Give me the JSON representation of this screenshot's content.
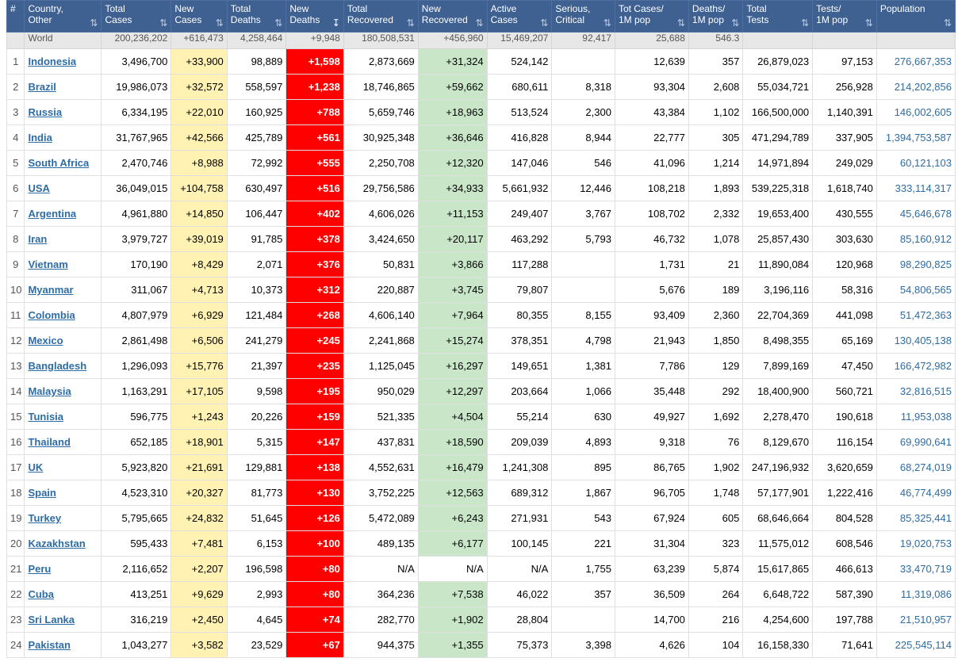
{
  "colors": {
    "header_bg": "#3e6192",
    "new_cases_bg": "#fff2b3",
    "new_deaths_bg": "#ff0000",
    "new_recovered_bg": "#c9e6c9",
    "link": "#2e6ca4"
  },
  "columns": [
    {
      "key": "rank",
      "label": "#",
      "sort": "none"
    },
    {
      "key": "country",
      "label": "Country,\nOther",
      "sort": "sort-icon"
    },
    {
      "key": "total_cases",
      "label": "Total\nCases",
      "sort": "sort-icon"
    },
    {
      "key": "new_cases",
      "label": "New\nCases",
      "sort": "sort-icon"
    },
    {
      "key": "total_deaths",
      "label": "Total\nDeaths",
      "sort": "sort-icon"
    },
    {
      "key": "new_deaths",
      "label": "New\nDeaths",
      "sort": "sort-desc-icon"
    },
    {
      "key": "total_recovered",
      "label": "Total\nRecovered",
      "sort": "sort-icon"
    },
    {
      "key": "new_recovered",
      "label": "New\nRecovered",
      "sort": "sort-icon"
    },
    {
      "key": "active_cases",
      "label": "Active\nCases",
      "sort": "sort-icon"
    },
    {
      "key": "serious",
      "label": "Serious,\nCritical",
      "sort": "sort-icon"
    },
    {
      "key": "cases_per_1m",
      "label": "Tot Cases/\n1M pop",
      "sort": "sort-icon"
    },
    {
      "key": "deaths_per_1m",
      "label": "Deaths/\n1M pop",
      "sort": "sort-icon"
    },
    {
      "key": "total_tests",
      "label": "Total\nTests",
      "sort": "sort-icon"
    },
    {
      "key": "tests_per_1m",
      "label": "Tests/\n1M pop",
      "sort": "sort-icon"
    },
    {
      "key": "population",
      "label": "Population",
      "sort": "sort-icon"
    }
  ],
  "world": [
    "",
    "World",
    "200,236,202",
    "+616,473",
    "4,258,464",
    "+9,948",
    "180,508,531",
    "+456,960",
    "15,469,207",
    "92,417",
    "25,688",
    "546.3",
    "",
    "",
    ""
  ],
  "rows": [
    [
      "1",
      "Indonesia",
      "3,496,700",
      "+33,900",
      "98,889",
      "+1,598",
      "2,873,669",
      "+31,324",
      "524,142",
      "",
      "12,639",
      "357",
      "26,879,023",
      "97,153",
      "276,667,353"
    ],
    [
      "2",
      "Brazil",
      "19,986,073",
      "+32,572",
      "558,597",
      "+1,238",
      "18,746,865",
      "+59,662",
      "680,611",
      "8,318",
      "93,304",
      "2,608",
      "55,034,721",
      "256,928",
      "214,202,856"
    ],
    [
      "3",
      "Russia",
      "6,334,195",
      "+22,010",
      "160,925",
      "+788",
      "5,659,746",
      "+18,963",
      "513,524",
      "2,300",
      "43,384",
      "1,102",
      "166,500,000",
      "1,140,391",
      "146,002,605"
    ],
    [
      "4",
      "India",
      "31,767,965",
      "+42,566",
      "425,789",
      "+561",
      "30,925,348",
      "+36,646",
      "416,828",
      "8,944",
      "22,777",
      "305",
      "471,294,789",
      "337,905",
      "1,394,753,587"
    ],
    [
      "5",
      "South Africa",
      "2,470,746",
      "+8,988",
      "72,992",
      "+555",
      "2,250,708",
      "+12,320",
      "147,046",
      "546",
      "41,096",
      "1,214",
      "14,971,894",
      "249,029",
      "60,121,103"
    ],
    [
      "6",
      "USA",
      "36,049,015",
      "+104,758",
      "630,497",
      "+516",
      "29,756,586",
      "+34,933",
      "5,661,932",
      "12,446",
      "108,218",
      "1,893",
      "539,225,318",
      "1,618,740",
      "333,114,317"
    ],
    [
      "7",
      "Argentina",
      "4,961,880",
      "+14,850",
      "106,447",
      "+402",
      "4,606,026",
      "+11,153",
      "249,407",
      "3,767",
      "108,702",
      "2,332",
      "19,653,400",
      "430,555",
      "45,646,678"
    ],
    [
      "8",
      "Iran",
      "3,979,727",
      "+39,019",
      "91,785",
      "+378",
      "3,424,650",
      "+20,117",
      "463,292",
      "5,793",
      "46,732",
      "1,078",
      "25,857,430",
      "303,630",
      "85,160,912"
    ],
    [
      "9",
      "Vietnam",
      "170,190",
      "+8,429",
      "2,071",
      "+376",
      "50,831",
      "+3,866",
      "117,288",
      "",
      "1,731",
      "21",
      "11,890,084",
      "120,968",
      "98,290,825"
    ],
    [
      "10",
      "Myanmar",
      "311,067",
      "+4,713",
      "10,373",
      "+312",
      "220,887",
      "+3,745",
      "79,807",
      "",
      "5,676",
      "189",
      "3,196,116",
      "58,316",
      "54,806,565"
    ],
    [
      "11",
      "Colombia",
      "4,807,979",
      "+6,929",
      "121,484",
      "+268",
      "4,606,140",
      "+7,964",
      "80,355",
      "8,155",
      "93,409",
      "2,360",
      "22,704,369",
      "441,098",
      "51,472,363"
    ],
    [
      "12",
      "Mexico",
      "2,861,498",
      "+6,506",
      "241,279",
      "+245",
      "2,241,868",
      "+15,274",
      "378,351",
      "4,798",
      "21,943",
      "1,850",
      "8,498,355",
      "65,169",
      "130,405,138"
    ],
    [
      "13",
      "Bangladesh",
      "1,296,093",
      "+15,776",
      "21,397",
      "+235",
      "1,125,045",
      "+16,297",
      "149,651",
      "1,381",
      "7,786",
      "129",
      "7,899,169",
      "47,450",
      "166,472,982"
    ],
    [
      "14",
      "Malaysia",
      "1,163,291",
      "+17,105",
      "9,598",
      "+195",
      "950,029",
      "+12,297",
      "203,664",
      "1,066",
      "35,448",
      "292",
      "18,400,900",
      "560,721",
      "32,816,515"
    ],
    [
      "15",
      "Tunisia",
      "596,775",
      "+1,243",
      "20,226",
      "+159",
      "521,335",
      "+4,504",
      "55,214",
      "630",
      "49,927",
      "1,692",
      "2,278,470",
      "190,618",
      "11,953,038"
    ],
    [
      "16",
      "Thailand",
      "652,185",
      "+18,901",
      "5,315",
      "+147",
      "437,831",
      "+18,590",
      "209,039",
      "4,893",
      "9,318",
      "76",
      "8,129,670",
      "116,154",
      "69,990,641"
    ],
    [
      "17",
      "UK",
      "5,923,820",
      "+21,691",
      "129,881",
      "+138",
      "4,552,631",
      "+16,479",
      "1,241,308",
      "895",
      "86,765",
      "1,902",
      "247,196,932",
      "3,620,659",
      "68,274,019"
    ],
    [
      "18",
      "Spain",
      "4,523,310",
      "+20,327",
      "81,773",
      "+130",
      "3,752,225",
      "+12,563",
      "689,312",
      "1,867",
      "96,705",
      "1,748",
      "57,177,901",
      "1,222,416",
      "46,774,499"
    ],
    [
      "19",
      "Turkey",
      "5,795,665",
      "+24,832",
      "51,645",
      "+126",
      "5,472,089",
      "+6,243",
      "271,931",
      "543",
      "67,924",
      "605",
      "68,646,664",
      "804,528",
      "85,325,441"
    ],
    [
      "20",
      "Kazakhstan",
      "595,433",
      "+7,481",
      "6,153",
      "+100",
      "489,135",
      "+6,177",
      "100,145",
      "221",
      "31,304",
      "323",
      "11,575,012",
      "608,546",
      "19,020,753"
    ],
    [
      "21",
      "Peru",
      "2,116,652",
      "+2,207",
      "196,598",
      "+80",
      "N/A",
      "N/A",
      "N/A",
      "1,755",
      "63,239",
      "5,874",
      "15,617,865",
      "466,613",
      "33,470,719"
    ],
    [
      "22",
      "Cuba",
      "413,251",
      "+9,629",
      "2,993",
      "+80",
      "364,236",
      "+7,538",
      "46,022",
      "357",
      "36,509",
      "264",
      "6,648,722",
      "587,390",
      "11,319,086"
    ],
    [
      "23",
      "Sri Lanka",
      "316,219",
      "+2,450",
      "4,645",
      "+74",
      "282,770",
      "+1,902",
      "28,804",
      "",
      "14,700",
      "216",
      "4,254,600",
      "197,788",
      "21,510,957"
    ],
    [
      "24",
      "Pakistan",
      "1,043,277",
      "+3,582",
      "23,529",
      "+67",
      "944,375",
      "+1,355",
      "75,373",
      "3,398",
      "4,626",
      "104",
      "16,158,330",
      "71,641",
      "225,545,114"
    ]
  ]
}
